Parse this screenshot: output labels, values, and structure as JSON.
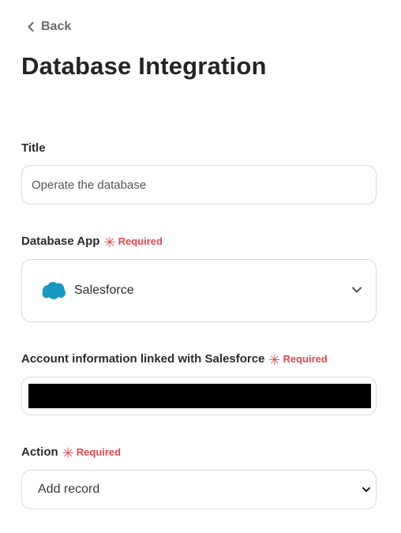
{
  "nav": {
    "back_label": "Back"
  },
  "page": {
    "title": "Database Integration"
  },
  "fields": {
    "title": {
      "label": "Title",
      "value": "Operate the database"
    },
    "database_app": {
      "label": "Database App",
      "required_label": "Required",
      "value": "Salesforce",
      "icon": "salesforce-cloud-icon"
    },
    "account": {
      "label": "Account information linked with Salesforce",
      "required_label": "Required",
      "value_redacted": true
    },
    "action": {
      "label": "Action",
      "required_label": "Required",
      "value": "Add record"
    }
  },
  "colors": {
    "required": "#e5484d",
    "salesforce_blue": "#1798c1",
    "border": "#d9d9d9",
    "text": "#2b2b2b"
  }
}
